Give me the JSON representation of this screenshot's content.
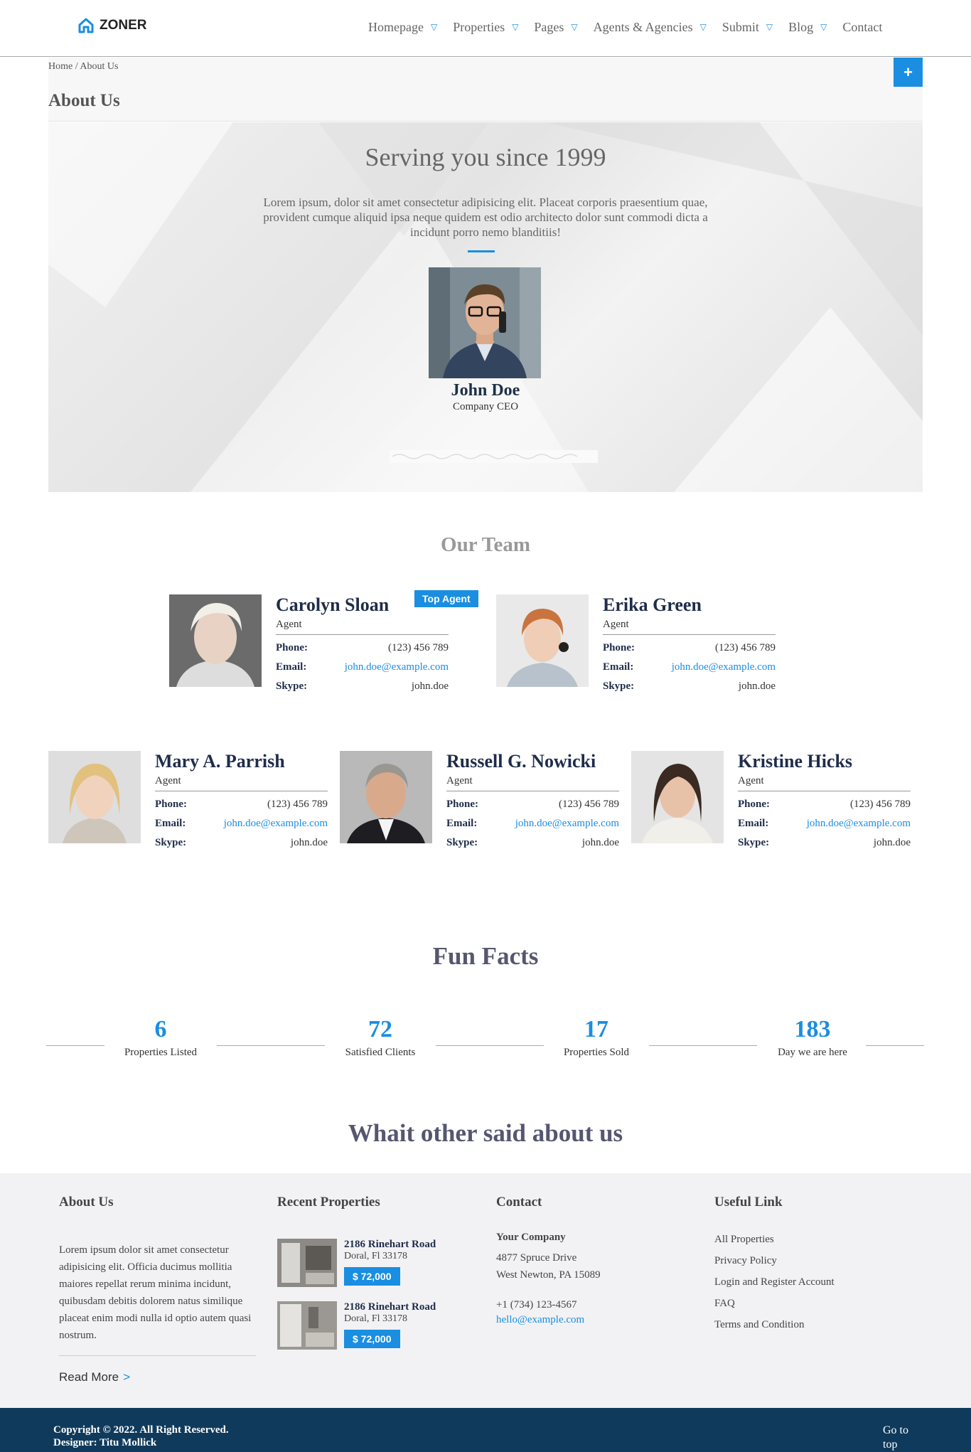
{
  "header": {
    "logo_text": "ZONER",
    "nav": [
      {
        "label": "Homepage",
        "caret": true
      },
      {
        "label": "Properties",
        "caret": true
      },
      {
        "label": "Pages",
        "caret": true
      },
      {
        "label": "Agents & Agencies",
        "caret": true
      },
      {
        "label": "Submit",
        "caret": true
      },
      {
        "label": "Blog",
        "caret": true
      },
      {
        "label": "Contact",
        "caret": false
      }
    ]
  },
  "breadcrumb": {
    "text": "Home / About Us",
    "page_title": "About Us",
    "add_button": "+"
  },
  "hero": {
    "title": "Serving you since 1999",
    "text": "Lorem ipsum, dolor sit amet consectetur adipisicing elit. Placeat corporis praesentium quae, provident cumque aliquid ipsa neque quidem est odio architecto dolor sunt commodi dicta a incidunt porro nemo blanditiis!",
    "person_name": "John Doe",
    "person_role": "Company CEO"
  },
  "team": {
    "title": "Our Team",
    "agents": [
      {
        "name": "Carolyn Sloan",
        "role": "Agent",
        "phone_label": "Phone:",
        "phone": "(123) 456 789",
        "email_label": "Email:",
        "email": "john.doe@example.com",
        "skype_label": "Skype:",
        "skype": "john.doe",
        "badge": "Top Agent"
      },
      {
        "name": "Erika Green",
        "role": "Agent",
        "phone_label": "Phone:",
        "phone": "(123) 456 789",
        "email_label": "Email:",
        "email": "john.doe@example.com",
        "skype_label": "Skype:",
        "skype": "john.doe"
      },
      {
        "name": "Mary A. Parrish",
        "role": "Agent",
        "phone_label": "Phone:",
        "phone": "(123) 456 789",
        "email_label": "Email:",
        "email": "john.doe@example.com",
        "skype_label": "Skype:",
        "skype": "john.doe"
      },
      {
        "name": "Russell G. Nowicki",
        "role": "Agent",
        "phone_label": "Phone:",
        "phone": "(123) 456 789",
        "email_label": "Email:",
        "email": "john.doe@example.com",
        "skype_label": "Skype:",
        "skype": "john.doe"
      },
      {
        "name": "Kristine Hicks",
        "role": "Agent",
        "phone_label": "Phone:",
        "phone": "(123) 456 789",
        "email_label": "Email:",
        "email": "john.doe@example.com",
        "skype_label": "Skype:",
        "skype": "john.doe"
      }
    ]
  },
  "facts": {
    "title": "Fun Facts",
    "items": [
      {
        "value": "6",
        "label": "Properties Listed"
      },
      {
        "value": "72",
        "label": "Satisfied Clients"
      },
      {
        "value": "17",
        "label": "Properties Sold"
      },
      {
        "value": "183",
        "label": "Day we are here"
      }
    ]
  },
  "testimonials": {
    "title": "Whait other said about us"
  },
  "footer": {
    "about": {
      "heading": "About Us",
      "text": "Lorem ipsum dolor sit amet consectetur adipisicing elit. Officia ducimus mollitia maiores repellat rerum minima incidunt, quibusdam debitis dolorem natus similique placeat enim modi nulla id optio autem quasi nostrum.",
      "read_more": "Read More",
      "read_more_arrow": ">"
    },
    "recent": {
      "heading": "Recent Properties",
      "items": [
        {
          "title": "2186 Rinehart Road",
          "address": "Doral, Fl 33178",
          "price": "$ 72,000"
        },
        {
          "title": "2186 Rinehart Road",
          "address": "Doral, Fl 33178",
          "price": "$ 72,000"
        }
      ]
    },
    "contact": {
      "heading": "Contact",
      "company": "Your Company",
      "address1": "4877 Spruce Drive",
      "address2": "West Newton, PA 15089",
      "phone": "+1 (734) 123-4567",
      "email": "hello@example.com"
    },
    "links": {
      "heading": "Useful Link",
      "items": [
        "All Properties",
        "Privacy Policy",
        "Login and Register Account",
        "FAQ",
        "Terms and Condition"
      ]
    }
  },
  "bottom": {
    "copyright": "Copyright © 2022. All Right Reserved.",
    "designer": "Designer: Titu Mollick",
    "go_top": "Go to top"
  },
  "colors": {
    "accent": "#1a8ee1",
    "footer_bar": "#0f3a5c",
    "heading_dark": "#1f2c4a"
  }
}
